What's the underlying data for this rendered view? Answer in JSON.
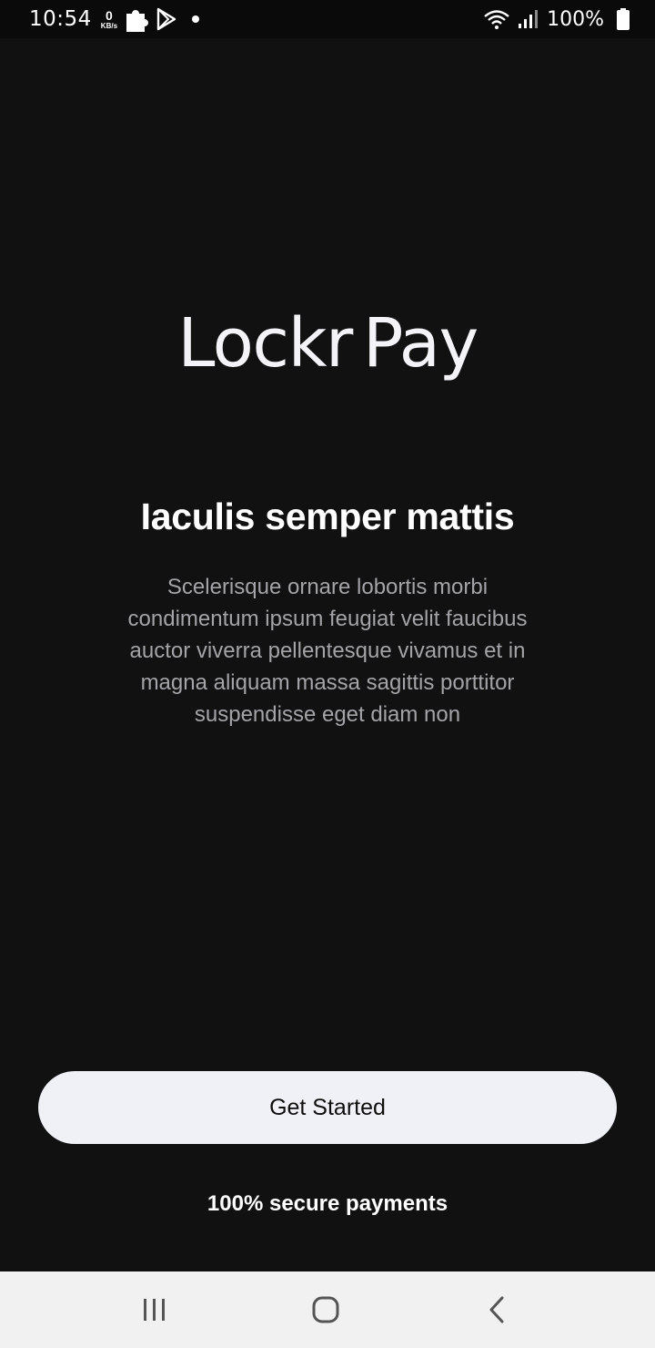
{
  "status_bar": {
    "time": "10:54",
    "net_speed_value": "0",
    "net_speed_unit": "KB/s",
    "battery": "100%",
    "icons": [
      "puzzle-icon",
      "play-store-icon",
      "notification-dot",
      "wifi-icon",
      "signal-icon",
      "battery-icon"
    ]
  },
  "logo": {
    "part1": "Lockr",
    "part2": "Pay"
  },
  "intro": {
    "headline": "Iaculis semper mattis",
    "description": "Scelerisque ornare lobortis morbi condimentum ipsum feugiat velit faucibus auctor viverra pellentesque vivamus et in magna aliquam massa sagittis porttitor suspendisse eget diam non"
  },
  "cta": {
    "label": "Get Started"
  },
  "footer": {
    "secure_text": "100% secure payments"
  },
  "nav_bar": {
    "icons": [
      "recents-icon",
      "home-icon",
      "back-icon"
    ]
  },
  "colors": {
    "background": "#111112",
    "button_bg": "#f0f1f7",
    "text_primary": "#ffffff",
    "text_muted": "#a4a4a8"
  }
}
